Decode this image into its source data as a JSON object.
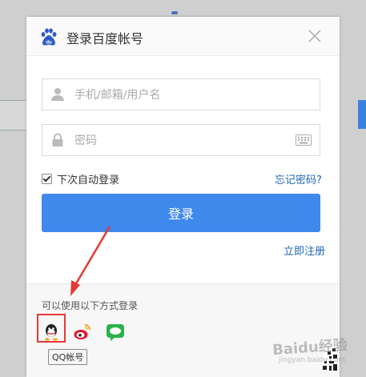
{
  "dialog": {
    "title": "登录百度帐号",
    "username_placeholder": "手机/邮箱/用户名",
    "password_placeholder": "密码",
    "remember_label": "下次自动登录",
    "forgot_label": "忘记密码?",
    "login_label": "登录",
    "register_label": "立即注册"
  },
  "footer": {
    "other_label": "可以使用以下方式登录",
    "tooltip": "QQ帐号",
    "social": [
      "qq-icon",
      "weibo-icon",
      "wechat-icon"
    ]
  },
  "watermark": {
    "text": "Baidu经验",
    "sub": "jingyan.baidu.com"
  },
  "colors": {
    "accent": "#3f89ec",
    "link": "#2266bb",
    "annotation": "#e53935"
  }
}
